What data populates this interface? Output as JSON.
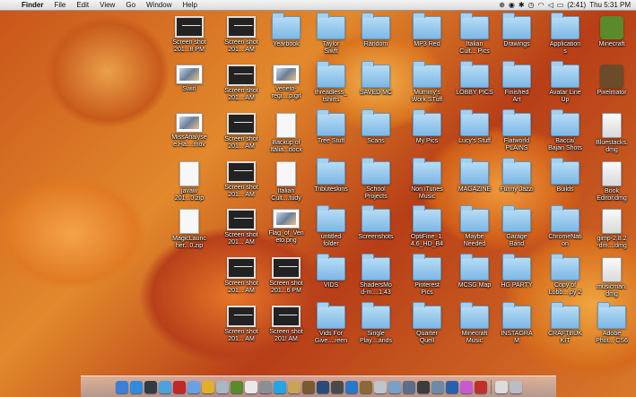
{
  "menubar": {
    "apple": "",
    "app_name": "Finder",
    "menus": [
      "File",
      "Edit",
      "View",
      "Go",
      "Window",
      "Help"
    ],
    "battery": "(2:41)",
    "clock": "Thu 5:31 PM"
  },
  "columns": [
    [
      {
        "label": "Screen shot\n201...8 PM",
        "kind": "screenshot"
      },
      {
        "label": "Swirl",
        "kind": "image"
      },
      {
        "label": "MissAnalyse\ne.Ha....mov",
        "kind": "image"
      },
      {
        "label": "javaw\n201...0.zip",
        "kind": "doc"
      },
      {
        "label": "MagicLaunc\nher...0.zip",
        "kind": "doc"
      }
    ],
    [
      {
        "label": "Screen shot\n201... AM",
        "kind": "screenshot"
      },
      {
        "label": "Screen shot\n201... AM",
        "kind": "screenshot"
      },
      {
        "label": "Screen shot\n201... AM",
        "kind": "screenshot"
      },
      {
        "label": "Screen shot\n201... AM",
        "kind": "screenshot"
      },
      {
        "label": "Screen shot\n201... AM",
        "kind": "screenshot"
      },
      {
        "label": "Screen shot\n201... AM",
        "kind": "screenshot"
      },
      {
        "label": "Screen shot\n201... AM",
        "kind": "screenshot"
      }
    ],
    [
      {
        "label": "Yearbook",
        "kind": "folder"
      },
      {
        "label": "veneto-\nregi....p.gif",
        "kind": "image"
      },
      {
        "label": "Backup of\nItalia...docx",
        "kind": "doc"
      },
      {
        "label": "Italian\nCult....tudy",
        "kind": "doc"
      },
      {
        "label": "Flag_of_Ven\neto.png",
        "kind": "image"
      },
      {
        "label": "Screen shot\n201...6 PM",
        "kind": "screenshot"
      },
      {
        "label": "Screen shot\n201! AM",
        "kind": "screenshot"
      }
    ],
    [
      {
        "label": "Taylor\nSiwft",
        "kind": "folder"
      },
      {
        "label": "threadless_\ntshirts",
        "kind": "folder"
      },
      {
        "label": "Tree Stuff",
        "kind": "folder"
      },
      {
        "label": "Tributeskins",
        "kind": "folder"
      },
      {
        "label": "untitled\nfolder",
        "kind": "folder"
      },
      {
        "label": "VIDS",
        "kind": "folder"
      },
      {
        "label": "Vids For\nGive....reen",
        "kind": "folder"
      }
    ],
    [
      {
        "label": "Random",
        "kind": "folder"
      },
      {
        "label": "SAVED MC",
        "kind": "folder"
      },
      {
        "label": "Scans",
        "kind": "folder"
      },
      {
        "label": "School\nProjects",
        "kind": "folder"
      },
      {
        "label": "Screenshots",
        "kind": "folder"
      },
      {
        "label": "ShadersMo\nd-m....1.43",
        "kind": "folder"
      },
      {
        "label": "Single\nPlay....ands",
        "kind": "folder"
      }
    ],
    [
      {
        "label": "MP3 Red",
        "kind": "folder"
      },
      {
        "label": "Mummy's\nWork STuff",
        "kind": "folder"
      },
      {
        "label": "My Pics",
        "kind": "folder"
      },
      {
        "label": "Non iTunes\nMusic",
        "kind": "folder"
      },
      {
        "label": "OptiFine_1.\n4.6_HD_B4",
        "kind": "folder"
      },
      {
        "label": "Pinterest\nPics",
        "kind": "folder"
      },
      {
        "label": "Quarter\nQuell",
        "kind": "folder"
      }
    ],
    [
      {
        "label": "Italian\nCult... Pics",
        "kind": "folder"
      },
      {
        "label": "LOBBY PICS",
        "kind": "folder"
      },
      {
        "label": "Lucy's Stuff",
        "kind": "folder"
      },
      {
        "label": "MAGAZINE",
        "kind": "folder"
      },
      {
        "label": "Maybe\nNeeded",
        "kind": "folder"
      },
      {
        "label": "MCSG Map",
        "kind": "folder"
      },
      {
        "label": "Minecraft\nMusic",
        "kind": "folder"
      }
    ],
    [
      {
        "label": "Drawings",
        "kind": "folder"
      },
      {
        "label": "Finished\nArt",
        "kind": "folder"
      },
      {
        "label": "Flatworld\nPLAINS",
        "kind": "folder"
      },
      {
        "label": "Funny Jazzi",
        "kind": "folder"
      },
      {
        "label": "Garage\nBand",
        "kind": "folder"
      },
      {
        "label": "HG PARTY",
        "kind": "folder"
      },
      {
        "label": "INSTAGRA\nM",
        "kind": "folder"
      }
    ],
    [
      {
        "label": "Application\ns",
        "kind": "folder"
      },
      {
        "label": "Avatar Line\nUp",
        "kind": "folder"
      },
      {
        "label": "Bacca/\nBajan Shots",
        "kind": "folder"
      },
      {
        "label": "Builds",
        "kind": "folder"
      },
      {
        "label": "ChromeNati\non",
        "kind": "folder"
      },
      {
        "label": "Copy of\nLobb....py 2",
        "kind": "folder"
      },
      {
        "label": "CRAFTBUK\nKIT",
        "kind": "folder"
      }
    ],
    [
      {
        "label": "Minecraft",
        "kind": "app",
        "color": "#5a8a2a"
      },
      {
        "label": "Pixelmator",
        "kind": "app",
        "color": "#6b4b2a"
      },
      {
        "label": "Bluestacks.\ndmg",
        "kind": "dmg"
      },
      {
        "label": "Book\nEditor.dmg",
        "kind": "dmg"
      },
      {
        "label": "gimp-2.8.2\n-dm....dmg",
        "kind": "dmg"
      },
      {
        "label": "musicman.\ndmg",
        "kind": "dmg"
      },
      {
        "label": "Adobe\nPhot... CS6",
        "kind": "folder"
      }
    ]
  ],
  "dock": [
    {
      "name": "finder-icon",
      "color": "#3d7fd6"
    },
    {
      "name": "app-store-icon",
      "color": "#2f8be0"
    },
    {
      "name": "dashboard-icon",
      "color": "#333a44"
    },
    {
      "name": "safari-icon",
      "color": "#4aa3df"
    },
    {
      "name": "photo-booth-icon",
      "color": "#c0282a"
    },
    {
      "name": "itunes-icon",
      "color": "#6aa0e8"
    },
    {
      "name": "chrome-icon",
      "color": "#e0b02a"
    },
    {
      "name": "mail-icon",
      "color": "#aab6c3"
    },
    {
      "name": "minecraft-dock-icon",
      "color": "#5a8a2a"
    },
    {
      "name": "document-icon",
      "color": "#e9e9e9"
    },
    {
      "name": "system-preferences-icon",
      "color": "#8a8f96"
    },
    {
      "name": "skype-icon",
      "color": "#22a6e8"
    },
    {
      "name": "script-icon",
      "color": "#caa35a"
    },
    {
      "name": "pixelmator-dock-icon",
      "color": "#7a5a33"
    },
    {
      "name": "quicktime-icon",
      "color": "#2a4a7a"
    },
    {
      "name": "utility-icon",
      "color": "#4a4a4a"
    },
    {
      "name": "folder-blue-icon",
      "color": "#2a76c8"
    },
    {
      "name": "photo-icon",
      "color": "#8a6a3a"
    },
    {
      "name": "help-icon",
      "color": "#bfc4cc"
    },
    {
      "name": "preview-icon",
      "color": "#7aa0c8"
    },
    {
      "name": "stack-icon",
      "color": "#5b6f8c"
    },
    {
      "name": "mac-icon",
      "color": "#3c3c3c"
    },
    {
      "name": "battery-app-icon",
      "color": "#6c8aa6"
    },
    {
      "name": "word-icon",
      "color": "#2a5fb0"
    },
    {
      "name": "pinwheel-icon",
      "color": "#c75ad0"
    },
    {
      "name": "red-app-icon",
      "color": "#c0302a"
    },
    {
      "name": "downloads-icon",
      "color": "#dcdcdc"
    },
    {
      "name": "trash-icon",
      "color": "#b9bec4"
    }
  ]
}
